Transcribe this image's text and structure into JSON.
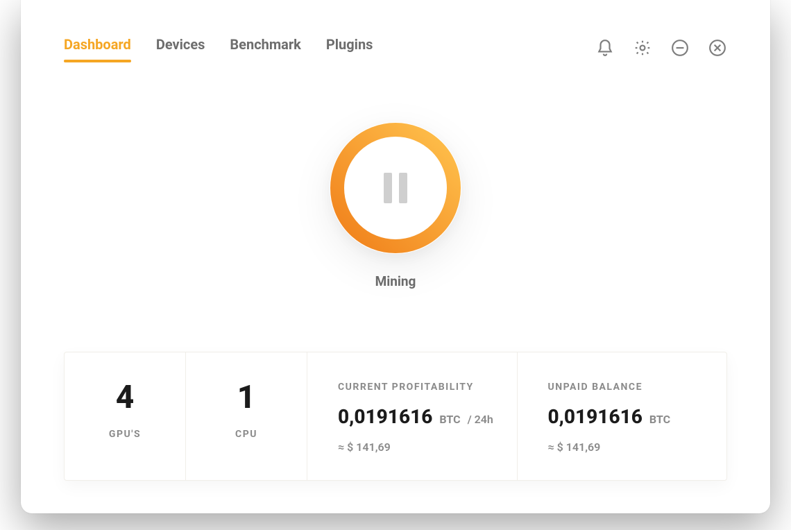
{
  "nav": {
    "tabs": [
      "Dashboard",
      "Devices",
      "Benchmark",
      "Plugins"
    ],
    "active_index": 0
  },
  "mining": {
    "status_label": "Mining"
  },
  "stats": {
    "gpu": {
      "count": "4",
      "label": "GPU'S"
    },
    "cpu": {
      "count": "1",
      "label": "CPU"
    },
    "profitability": {
      "caption": "CURRENT PROFITABILITY",
      "btc_value": "0,0191616",
      "btc_unit": "BTC",
      "per": "/ 24h",
      "approx": "≈ $ 141,69"
    },
    "balance": {
      "caption": "UNPAID BALANCE",
      "btc_value": "0,0191616",
      "btc_unit": "BTC",
      "approx": "≈ $ 141,69"
    }
  },
  "colors": {
    "accent": "#f5a623",
    "accent_dark": "#f07f1a"
  }
}
